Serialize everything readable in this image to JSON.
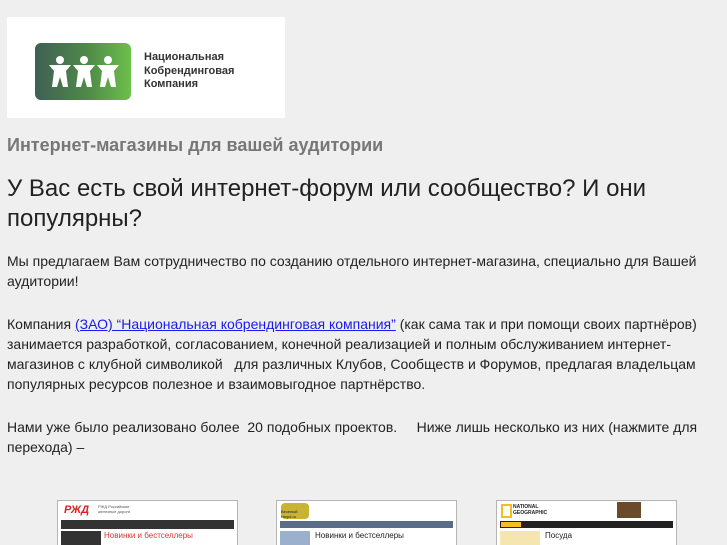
{
  "logo": {
    "lines": [
      "Национальная",
      "Кобрендинговая",
      "Компания"
    ]
  },
  "subtitle": "Интернет-магазины для вашей аудитории",
  "headline": "У Вас есть свой интернет-форум или сообщество? И они популярны?",
  "paragraphs": {
    "p1": [
      "Мы предлагаем Вам сотрудничество по созданию отдельного интернет-магазина, специально для Вашей",
      "аудитории!"
    ],
    "p2_prefix": "Компания ",
    "p2_link": "(ЗАО) “Национальная кобрендинговая компания”",
    "p2_suffix": " (как сама так и при помощи своих партнёров)",
    "p2_lines": [
      "занимается разработкой, согласованием, конечной реализацией и полным обслуживанием интернет-",
      "магазинов с клубной символикой   для различных Клубов, Сообществ и Форумов, предлагая владельцам",
      "популярных ресурсов полезное и взаимовыгодное партнёрство."
    ],
    "p3": [
      "Нами уже было реализовано более  20 подобных проектов.     Ниже лишь несколько из них (нажмите для",
      "перехода) –"
    ]
  },
  "projects": [
    {
      "name": "РЖД Российские железные дороги",
      "heading": "Новинки и бестселлеры"
    },
    {
      "name": "Веселый Нюрd.ru",
      "heading": "Новинки и бестселлеры"
    },
    {
      "name": "NATIONAL GEOGRAPHIC",
      "heading": "Посуда"
    }
  ]
}
